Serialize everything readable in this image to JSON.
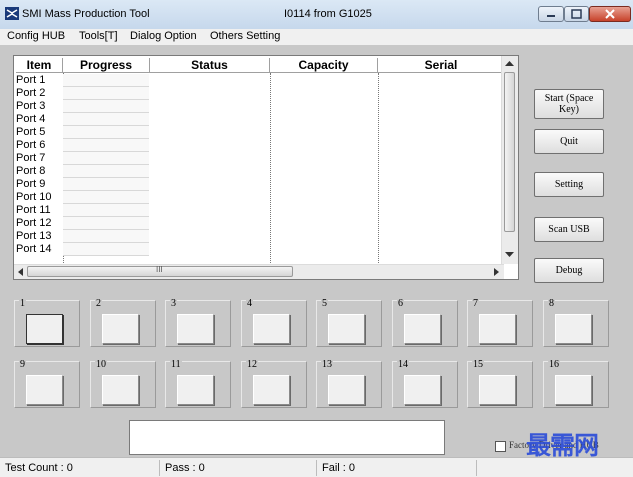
{
  "window": {
    "title": "SMI Mass Production Tool",
    "subtitle": "I0114 from G1025"
  },
  "menu": [
    "Config HUB",
    "Tools[T]",
    "Dialog Option",
    "Others Setting"
  ],
  "list": {
    "columns": [
      "Item",
      "Progress",
      "Status",
      "Capacity",
      "Serial"
    ],
    "rows": [
      "Port 1",
      "Port 2",
      "Port 3",
      "Port 4",
      "Port 5",
      "Port 6",
      "Port 7",
      "Port 8",
      "Port 9",
      "Port 10",
      "Port 11",
      "Port 12",
      "Port 13",
      "Port 14"
    ],
    "hscroll_grip": "III"
  },
  "buttons": {
    "start": "Start (Space Key)",
    "quit": "Quit",
    "setting": "Setting",
    "scan_usb": "Scan USB",
    "debug": "Debug"
  },
  "slots": [
    "1",
    "2",
    "3",
    "4",
    "5",
    "6",
    "7",
    "8",
    "9",
    "10",
    "11",
    "12",
    "13",
    "14",
    "15",
    "16"
  ],
  "checkbox_label": "Factory Driver and HUB",
  "watermark": "最需网",
  "status": {
    "test_count": "Test Count : 0",
    "pass": "Pass : 0",
    "fail": "Fail : 0"
  }
}
